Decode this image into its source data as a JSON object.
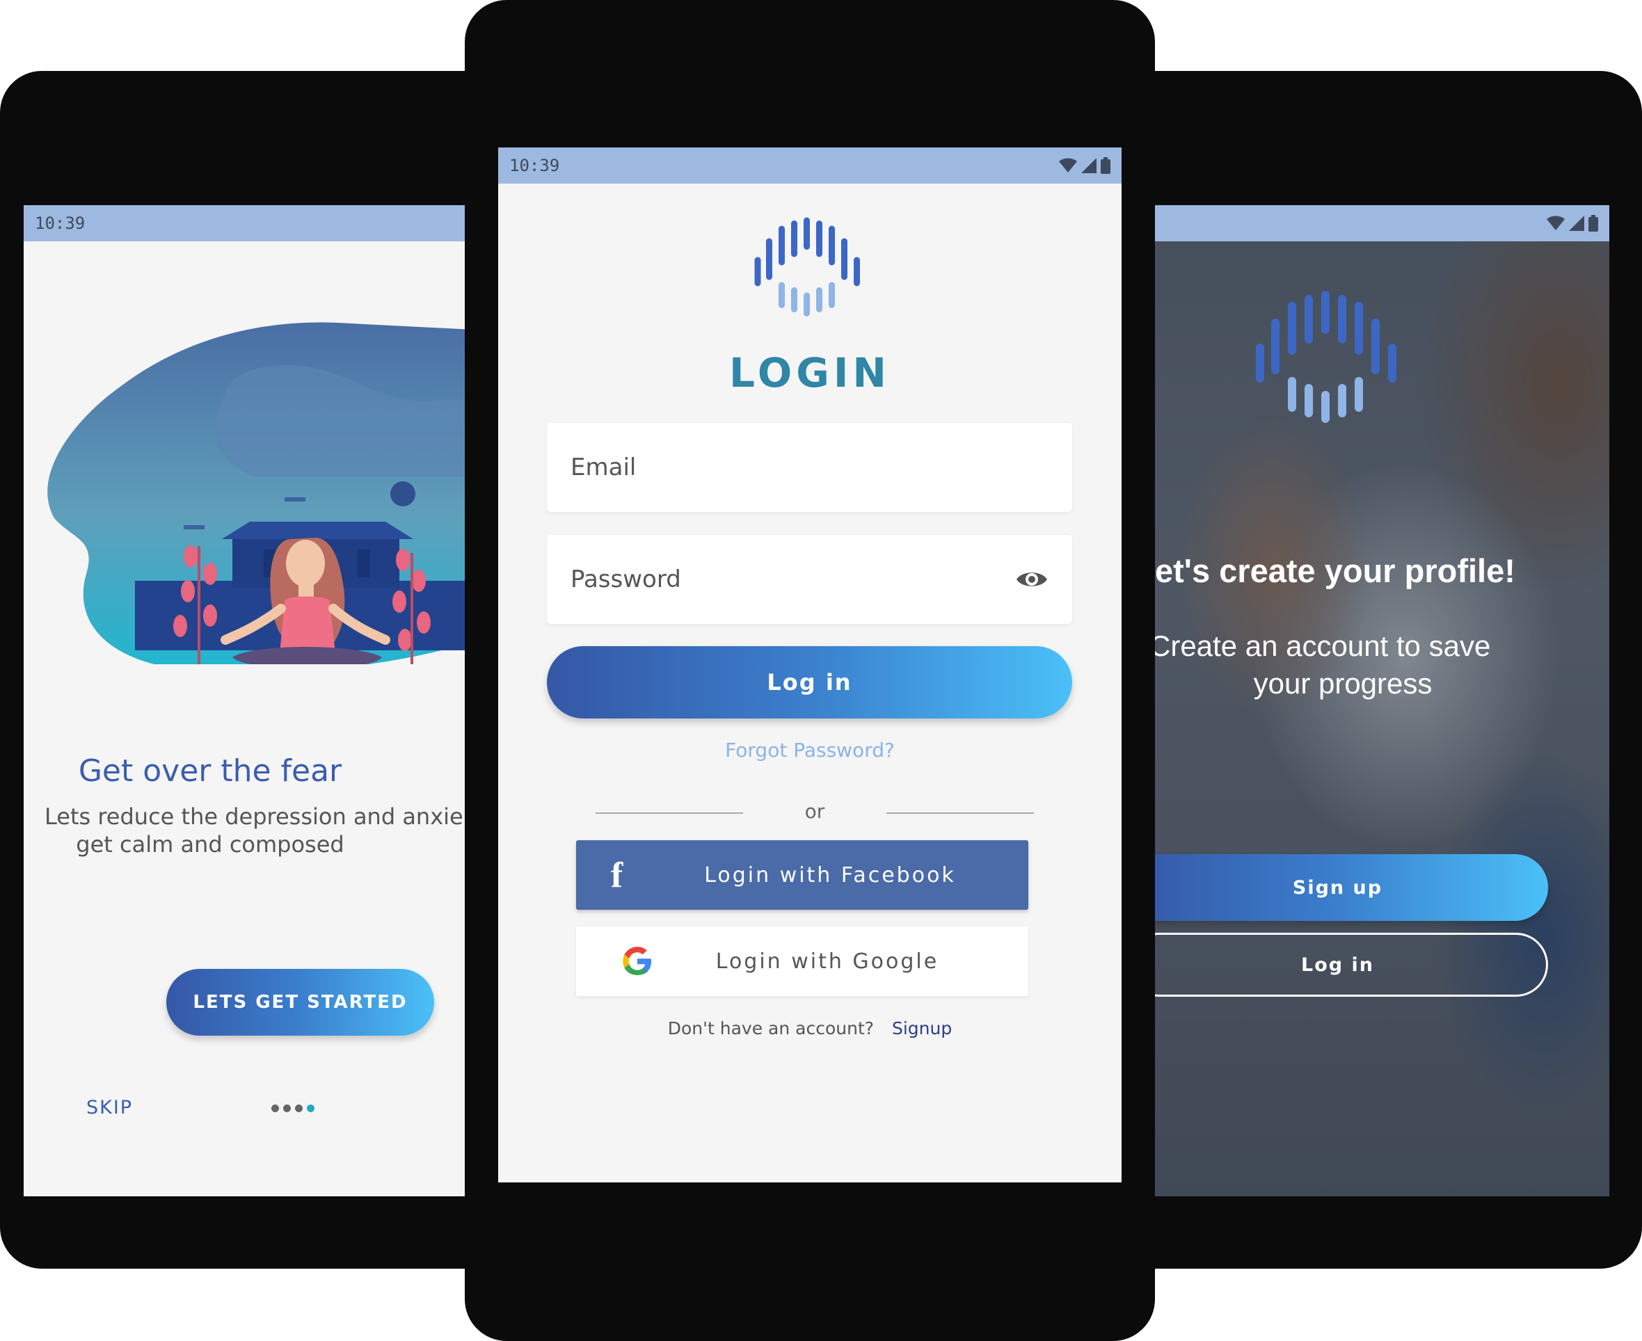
{
  "status": {
    "time": "10:39"
  },
  "left": {
    "headline": "Get over the fear",
    "body_line1": "Lets reduce the depression and anxie",
    "body_line2": "get calm and composed",
    "cta": "LETS GET STARTED",
    "skip": "SKIP",
    "pager": {
      "total": 4,
      "active": 4
    },
    "colors": {
      "accent": "#3a5db0",
      "teal": "#2aa7c2"
    }
  },
  "center": {
    "title": "LOGIN",
    "email_placeholder": "Email",
    "password_placeholder": "Password",
    "login_button": "Log in",
    "forgot": "Forgot Password?",
    "or": "or",
    "facebook": "Login with Facebook",
    "google": "Login with Google",
    "no_account": "Don't have an account?",
    "signup": "Signup",
    "colors": {
      "title": "#2f86a6",
      "facebook": "#4a6aa8",
      "forgot": "#8ab4e8"
    }
  },
  "right": {
    "headline": "et's create your profile!",
    "sub_line1": "Create an account to save",
    "sub_line2": "your progress",
    "signup": "Sign up",
    "login": "Log in"
  },
  "icons": {
    "status": [
      "wifi-icon",
      "signal-icon",
      "battery-icon"
    ],
    "password": "eye-icon",
    "facebook": "facebook-icon",
    "google": "google-icon",
    "logo": "app-logo-icon"
  }
}
